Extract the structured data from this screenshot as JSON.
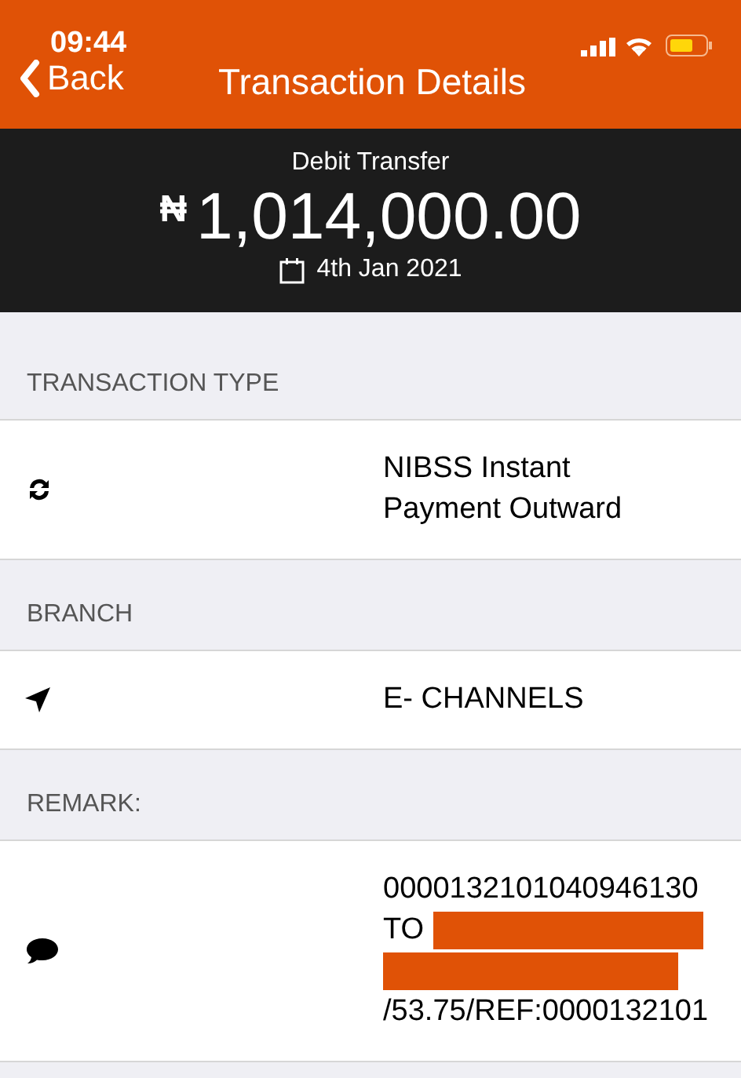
{
  "status_bar": {
    "time": "09:44"
  },
  "nav": {
    "back": "Back",
    "title": "Transaction Details"
  },
  "summary": {
    "type": "Debit Transfer",
    "currency": "₦",
    "amount": "1,014,000.00",
    "date": "4th Jan 2021"
  },
  "sections": [
    {
      "header": "TRANSACTION TYPE",
      "lines": [
        {
          "kind": "text",
          "text": "NIBSS Instant"
        },
        {
          "kind": "text",
          "text": "Payment Outward"
        }
      ]
    },
    {
      "header": "BRANCH",
      "lines": [
        {
          "kind": "text",
          "text": "E- CHANNELS"
        }
      ]
    },
    {
      "header": "REMARK:",
      "lines": [
        {
          "kind": "text",
          "text": "0000132101040946130"
        },
        {
          "kind": "text_redacted",
          "text": "TO"
        },
        {
          "kind": "redacted"
        },
        {
          "kind": "text",
          "text": "/53.75/REF:0000132101"
        }
      ]
    }
  ]
}
